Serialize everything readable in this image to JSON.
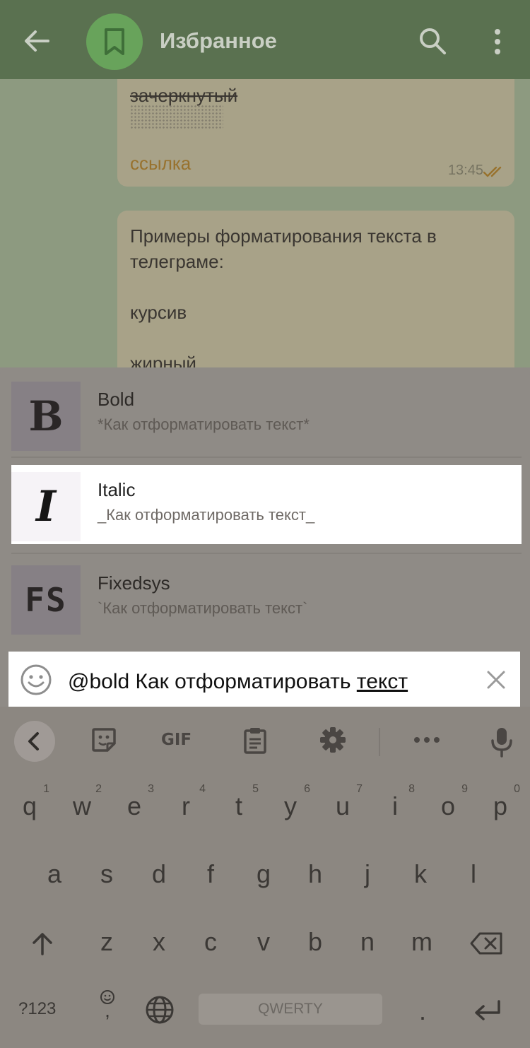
{
  "header": {
    "title": "Избранное"
  },
  "chat": {
    "bubble1": {
      "strike_text": "зачеркнутый",
      "link_text": "ссылка",
      "time": "13:45"
    },
    "bubble2": {
      "text": "Примеры форматирования текста в\nтелеграме:\n\nкурсив\n\nжирный"
    }
  },
  "suggestions": [
    {
      "icon_label": "B",
      "name": "Bold",
      "subtitle": "*Как отформатировать текст*"
    },
    {
      "icon_label": "I",
      "name": "Italic",
      "subtitle": "_Как отформатировать текст_"
    },
    {
      "icon_label": "FS",
      "name": "Fixedsys",
      "subtitle": "`Как отформатировать текст`"
    }
  ],
  "input": {
    "text_before": "@bold Как отформатировать ",
    "text_underlined": "текст"
  },
  "keyboard": {
    "toolbar": {
      "gif_label": "GIF"
    },
    "row1": [
      {
        "k": "q",
        "n": "1"
      },
      {
        "k": "w",
        "n": "2"
      },
      {
        "k": "e",
        "n": "3"
      },
      {
        "k": "r",
        "n": "4"
      },
      {
        "k": "t",
        "n": "5"
      },
      {
        "k": "y",
        "n": "6"
      },
      {
        "k": "u",
        "n": "7"
      },
      {
        "k": "i",
        "n": "8"
      },
      {
        "k": "o",
        "n": "9"
      },
      {
        "k": "p",
        "n": "0"
      }
    ],
    "row2": [
      "a",
      "s",
      "d",
      "f",
      "g",
      "h",
      "j",
      "k",
      "l"
    ],
    "row3": [
      "z",
      "x",
      "c",
      "v",
      "b",
      "n",
      "m"
    ],
    "symbols_label": "?123",
    "comma": ",",
    "space_label": "QWERTY",
    "period": "."
  }
}
